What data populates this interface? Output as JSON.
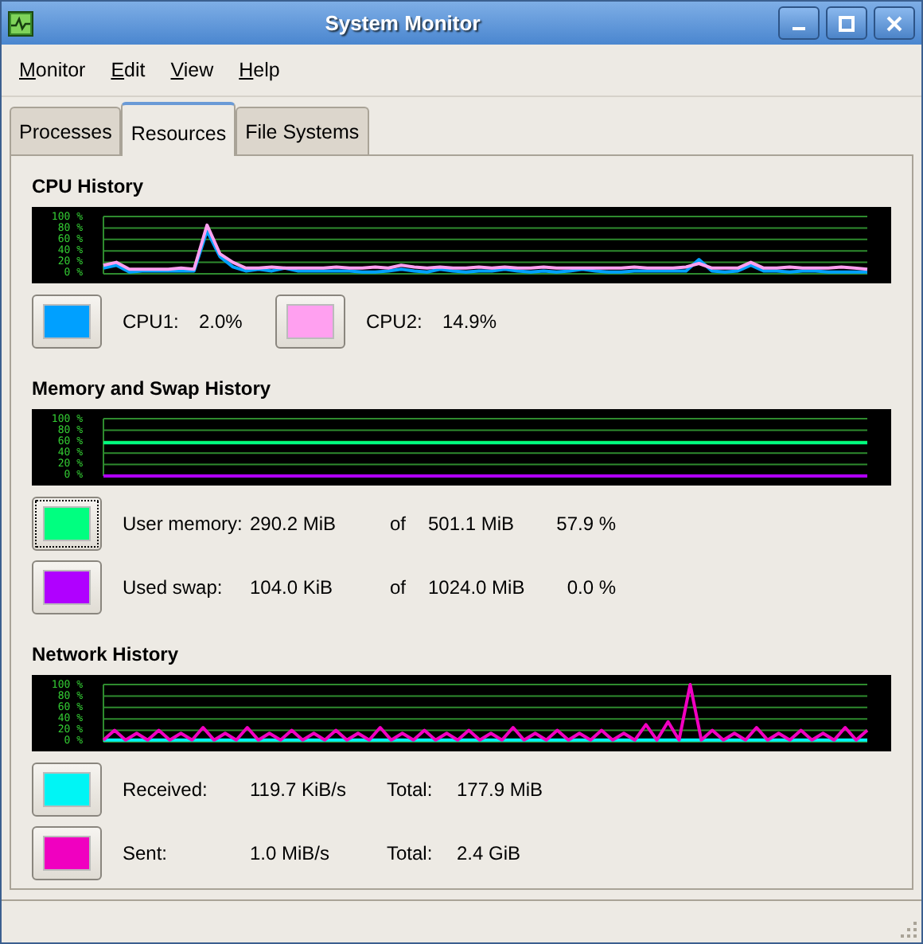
{
  "window": {
    "title": "System Monitor"
  },
  "menu": [
    {
      "label": "Monitor"
    },
    {
      "label": "Edit"
    },
    {
      "label": "View"
    },
    {
      "label": "Help"
    }
  ],
  "tabs": [
    {
      "label": "Processes",
      "selected": false
    },
    {
      "label": "Resources",
      "selected": true
    },
    {
      "label": "File Systems",
      "selected": false
    }
  ],
  "sections": [
    {
      "title": "CPU History",
      "kind": "cpu",
      "chart_data": {
        "type": "line",
        "grid": true,
        "ylim": [
          0,
          100
        ],
        "yticks": [
          {
            "value": 100,
            "label": "100 %"
          },
          {
            "value": 80,
            "label": "80 %"
          },
          {
            "value": 60,
            "label": "60 %"
          },
          {
            "value": 40,
            "label": "40 %"
          },
          {
            "value": 20,
            "label": "20 %"
          },
          {
            "value": 0,
            "label": "0 %"
          }
        ],
        "series": [
          {
            "color": "#00a0ff",
            "values": [
              10,
              15,
              3,
              5,
              5,
              5,
              5,
              5,
              75,
              30,
              12,
              5,
              8,
              5,
              10,
              5,
              5,
              5,
              5,
              5,
              3,
              3,
              5,
              8,
              5,
              3,
              8,
              5,
              3,
              5,
              5,
              8,
              5,
              3,
              5,
              3,
              5,
              8,
              5,
              3,
              3,
              5,
              5,
              5,
              5,
              5,
              25,
              5,
              3,
              5,
              15,
              5,
              5,
              3,
              5,
              5,
              3,
              3,
              3,
              3
            ]
          },
          {
            "color": "#ffa0f0",
            "values": [
              15,
              20,
              8,
              8,
              8,
              8,
              10,
              8,
              85,
              35,
              20,
              10,
              10,
              12,
              10,
              10,
              10,
              10,
              12,
              10,
              10,
              12,
              10,
              15,
              12,
              10,
              12,
              10,
              10,
              12,
              10,
              12,
              10,
              10,
              12,
              10,
              10,
              10,
              10,
              10,
              10,
              12,
              10,
              10,
              10,
              12,
              18,
              10,
              10,
              10,
              20,
              10,
              10,
              12,
              10,
              10,
              10,
              12,
              10,
              8
            ]
          }
        ]
      },
      "rows": [
        {
          "items": [
            {
              "color": "#00a0ff",
              "focused": false,
              "texts": [
                "CPU1:",
                "2.0%"
              ]
            },
            {
              "color": "#ffa0f0",
              "focused": false,
              "texts": [
                "CPU2:",
                "14.9%"
              ]
            }
          ]
        }
      ]
    },
    {
      "title": "Memory and Swap History",
      "kind": "memory",
      "chart_data": {
        "type": "line",
        "grid": true,
        "ylim": [
          0,
          100
        ],
        "yticks": [
          {
            "value": 100,
            "label": "100 %"
          },
          {
            "value": 80,
            "label": "80 %"
          },
          {
            "value": 60,
            "label": "60 %"
          },
          {
            "value": 40,
            "label": "40 %"
          },
          {
            "value": 20,
            "label": "20 %"
          },
          {
            "value": 0,
            "label": "0 %"
          }
        ],
        "series": [
          {
            "color": "#00ff80",
            "values": [
              58,
              58,
              58,
              58,
              58,
              58,
              58,
              58,
              58,
              58
            ]
          },
          {
            "color": "#b000ff",
            "values": [
              0,
              0,
              0,
              0,
              0,
              0,
              0,
              0,
              0,
              0
            ]
          }
        ]
      },
      "rows": [
        {
          "items": [
            {
              "color": "#00ff80",
              "focused": true,
              "texts": [
                "User memory:",
                "290.2 MiB",
                "of",
                "501.1 MiB",
                "57.9 %"
              ]
            }
          ]
        },
        {
          "items": [
            {
              "color": "#b000ff",
              "focused": false,
              "texts": [
                "Used swap:",
                "104.0 KiB",
                "of",
                "1024.0 MiB",
                "0.0 %"
              ]
            }
          ]
        }
      ]
    },
    {
      "title": "Network History",
      "kind": "network",
      "chart_data": {
        "type": "line",
        "grid": true,
        "ylim": [
          0,
          100
        ],
        "yticks": [
          {
            "value": 100,
            "label": "100 %"
          },
          {
            "value": 80,
            "label": "80 %"
          },
          {
            "value": 60,
            "label": "60 %"
          },
          {
            "value": 40,
            "label": "40 %"
          },
          {
            "value": 20,
            "label": "20 %"
          },
          {
            "value": 0,
            "label": "0 %"
          }
        ],
        "series": [
          {
            "color": "#00f5f5",
            "values": [
              3,
              3,
              3,
              3,
              3,
              3,
              3,
              3,
              3,
              3,
              3,
              3,
              3,
              3,
              3,
              3,
              3,
              3,
              3,
              3,
              3,
              3,
              3,
              3,
              3,
              3,
              3,
              3,
              3,
              3,
              3,
              3,
              3,
              3,
              3,
              3,
              3,
              3,
              3,
              3,
              3,
              3,
              3,
              3,
              3,
              3,
              3,
              3,
              3,
              3,
              3,
              3,
              3,
              3,
              3,
              3,
              3,
              3,
              3,
              3,
              3,
              3,
              3,
              3,
              3,
              3,
              3,
              3,
              3,
              3
            ]
          },
          {
            "color": "#f000c0",
            "values": [
              3,
              20,
              3,
              15,
              3,
              20,
              3,
              15,
              3,
              25,
              3,
              15,
              3,
              25,
              3,
              15,
              3,
              20,
              3,
              15,
              3,
              20,
              3,
              15,
              3,
              25,
              3,
              15,
              3,
              20,
              3,
              15,
              3,
              20,
              3,
              15,
              3,
              25,
              3,
              15,
              3,
              20,
              3,
              15,
              3,
              20,
              3,
              15,
              3,
              30,
              3,
              35,
              3,
              100,
              3,
              20,
              3,
              15,
              3,
              25,
              3,
              15,
              3,
              20,
              3,
              15,
              3,
              25,
              3,
              20
            ]
          }
        ]
      },
      "rows": [
        {
          "items": [
            {
              "color": "#00f5f5",
              "focused": false,
              "texts": [
                "Received:",
                "119.7 KiB/s",
                "Total:",
                "177.9 MiB"
              ]
            }
          ]
        },
        {
          "items": [
            {
              "color": "#f000c0",
              "focused": false,
              "texts": [
                "Sent:",
                "1.0 MiB/s",
                "Total:",
                "2.4 GiB"
              ]
            }
          ]
        }
      ]
    }
  ]
}
